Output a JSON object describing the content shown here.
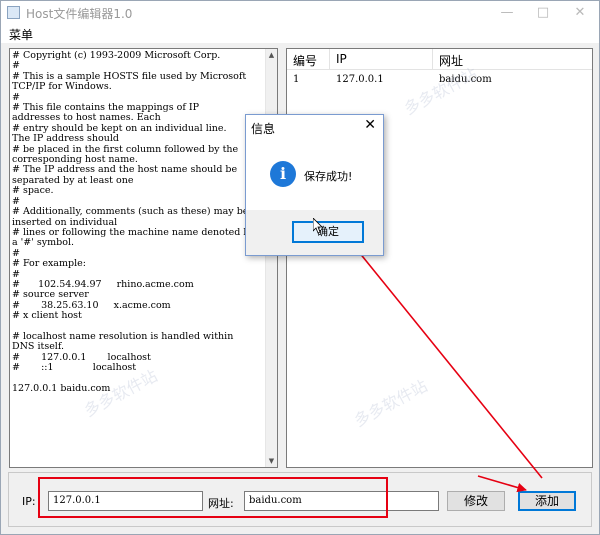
{
  "window": {
    "title": "Host文件编辑器1.0"
  },
  "menu": {
    "label": "菜单"
  },
  "editor": {
    "lines": [
      "# Copyright (c) 1993-2009 Microsoft Corp.",
      "#",
      "# This is a sample HOSTS file used by Microsoft",
      "TCP/IP for Windows.",
      "#",
      "# This file contains the mappings of IP",
      "addresses to host names. Each",
      "# entry should be kept on an individual line.",
      "The IP address should",
      "# be placed in the first column followed by the",
      "corresponding host name.",
      "# The IP address and the host name should be",
      "separated by at least one",
      "# space.",
      "#",
      "# Additionally, comments (such as these) may be",
      "inserted on individual",
      "# lines or following the machine name denoted by",
      "a '#' symbol.",
      "#",
      "# For example:",
      "#",
      "#      102.54.94.97     rhino.acme.com",
      "# source server",
      "#       38.25.63.10     x.acme.com",
      "# x client host",
      "",
      "# localhost name resolution is handled within",
      "DNS itself.",
      "#       127.0.0.1       localhost",
      "#       ::1             localhost",
      "",
      "127.0.0.1 baidu.com"
    ]
  },
  "table": {
    "headers": [
      "编号",
      "IP",
      "网址"
    ],
    "rows": [
      {
        "id": "1",
        "ip": "127.0.0.1",
        "url": "baidu.com"
      }
    ]
  },
  "form": {
    "ip_label": "IP:",
    "ip_value": "127.0.0.1",
    "url_label": "网址:",
    "url_value": "baidu.com",
    "edit_button": "修改",
    "add_button": "添加"
  },
  "dialog": {
    "title": "信息",
    "message": "保存成功!",
    "ok_button": "确定"
  },
  "watermarks": [
    "多多软件站",
    "多多软件站",
    "多多软件站"
  ],
  "colors": {
    "annotation": "#e60012",
    "accent": "#0078d7",
    "info_icon": "#1e78d8"
  },
  "icons": {
    "close": "close-icon",
    "minimize": "minimize-icon",
    "maximize": "maximize-icon",
    "info": "info-icon"
  }
}
